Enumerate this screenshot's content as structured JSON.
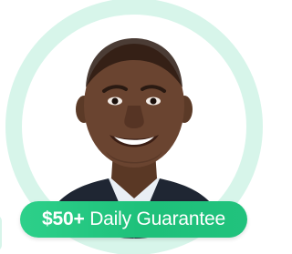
{
  "badge": {
    "amount": "$50+",
    "label": "Daily Guarantee"
  },
  "colors": {
    "ring": "#d7f5ea",
    "badge": "#22c57d",
    "badge_text": "#ffffff"
  }
}
